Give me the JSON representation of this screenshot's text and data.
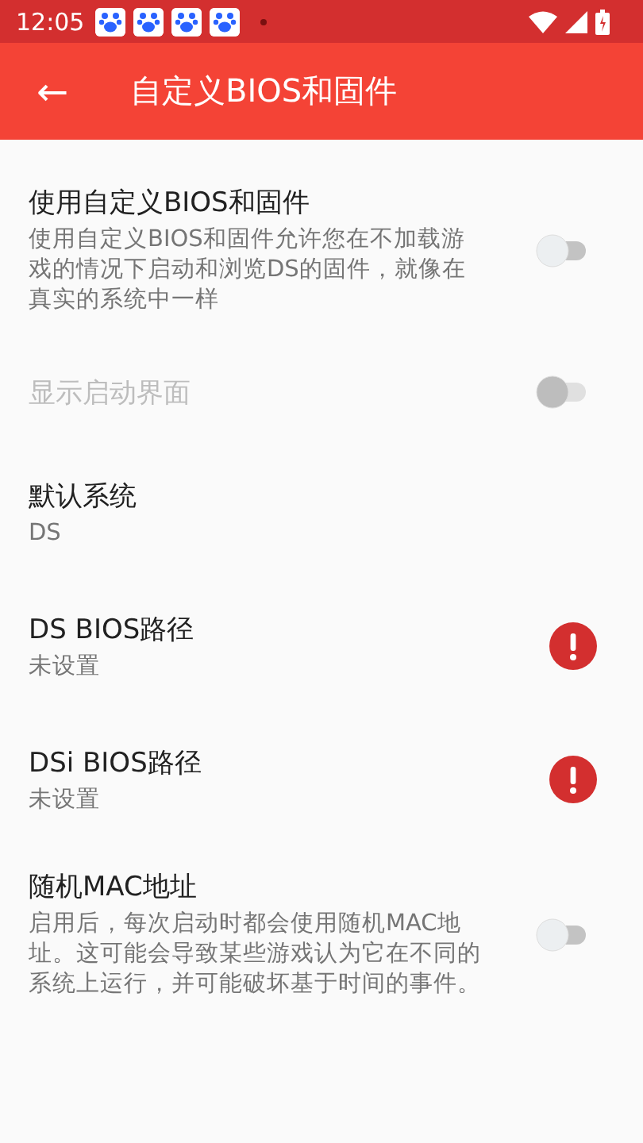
{
  "status_bar": {
    "time": "12:05",
    "notifications": [
      {
        "kind": "paw"
      },
      {
        "kind": "paw"
      },
      {
        "kind": "paw"
      },
      {
        "kind": "paw"
      },
      {
        "kind": "dot"
      }
    ]
  },
  "app_bar": {
    "back": "←",
    "title": "自定义BIOS和固件"
  },
  "settings": [
    {
      "kind": "switch",
      "title": "使用自定义BIOS和固件",
      "summary": "使用自定义BIOS和固件允许您在不加载游戏的情况下启动和浏览DS的固件，就像在真实的系统中一样",
      "on": false,
      "disabled": false
    },
    {
      "kind": "switch",
      "title": "显示启动界面",
      "on": false,
      "disabled": true
    },
    {
      "kind": "plain",
      "title": "默认系统",
      "summary": "DS"
    },
    {
      "kind": "warning",
      "title": "DS BIOS路径",
      "summary": "未设置"
    },
    {
      "kind": "warning",
      "title": "DSi BIOS路径",
      "summary": "未设置"
    },
    {
      "kind": "switch",
      "title": "随机MAC地址",
      "summary": "启用后，每次启动时都会使用随机MAC地址。这可能会导致某些游戏认为它在不同的系统上运行，并可能破坏基于时间的事件。",
      "on": false,
      "disabled": false
    }
  ]
}
